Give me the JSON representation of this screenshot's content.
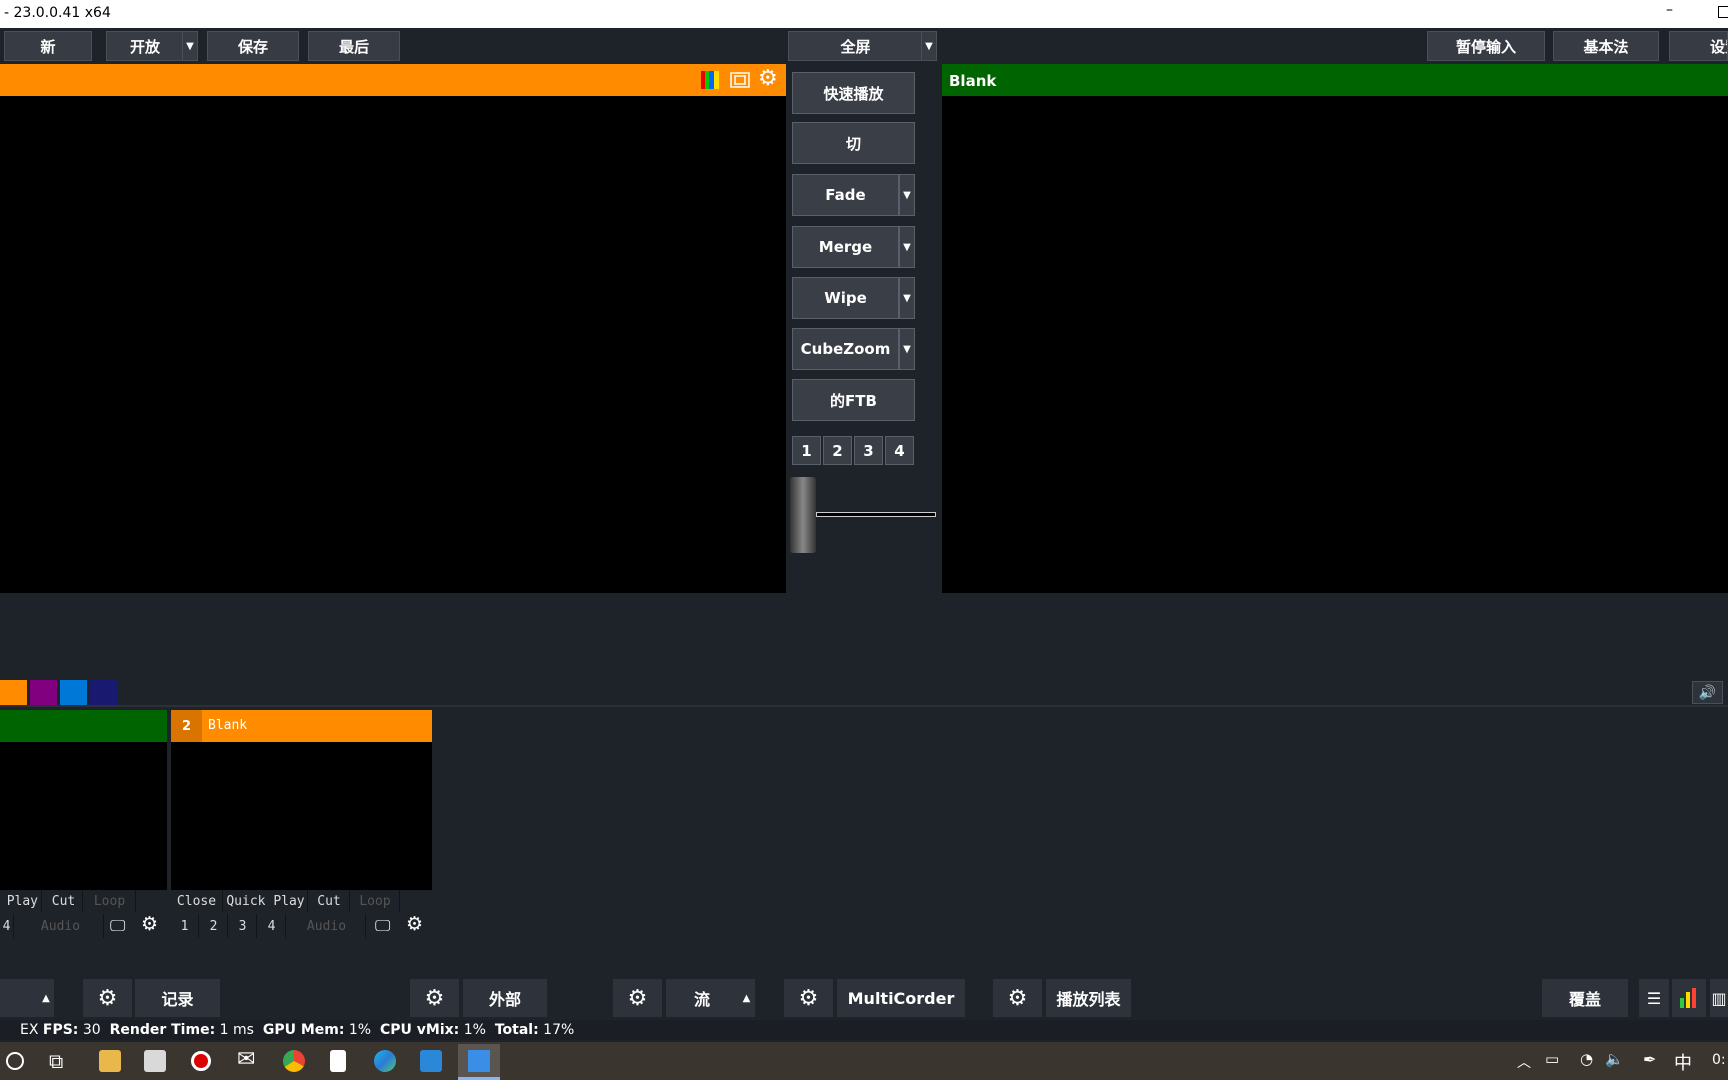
{
  "window": {
    "title": "- 23.0.0.41 x64",
    "min_glyph": "–"
  },
  "toolbar": {
    "new": "新",
    "open": "开放",
    "save": "保存",
    "last": "最后",
    "fullscreen": "全屏",
    "pause_input": "暂停输入",
    "basic": "基本法",
    "settings": "设置"
  },
  "output": {
    "label": "Blank"
  },
  "transitions": {
    "quick_play": "快速播放",
    "cut": "切",
    "fade": "Fade",
    "merge": "Merge",
    "wipe": "Wipe",
    "cubezoom": "CubeZoom",
    "ftb": "的FTB",
    "numbers": [
      "1",
      "2",
      "3",
      "4"
    ],
    "fader_position": 0.1
  },
  "colors": {
    "accent_orange": "#ff8c00",
    "output_green": "#006400",
    "blue": "#0078d7",
    "purple": "#800080",
    "navy": "#191970"
  },
  "input_tags": [
    "orange",
    "purple",
    "blue",
    "navy"
  ],
  "inputs": [
    {
      "header_color": "#006400",
      "controls": [
        "Play",
        "Cut",
        "Loop"
      ],
      "numbers": [
        "4"
      ],
      "audio": "Audio"
    },
    {
      "number": "2",
      "title": "Blank",
      "header_color": "#ff8c00",
      "controls": [
        "Close",
        "Quick Play",
        "Cut",
        "Loop"
      ],
      "numbers": [
        "1",
        "2",
        "3",
        "4"
      ],
      "audio": "Audio"
    }
  ],
  "bottom": {
    "record": "记录",
    "external": "外部",
    "stream": "流",
    "multicorder": "MultiCorder",
    "playlist": "播放列表",
    "overlay": "覆盖"
  },
  "status": {
    "mode": "EX",
    "fps_label": "FPS:",
    "fps": "30",
    "render_label": "Render Time:",
    "render": "1 ms",
    "gpu_label": "GPU Mem:",
    "gpu": "1%",
    "cpu_label": "CPU vMix:",
    "cpu": "1%",
    "total_label": "Total:",
    "total": "17%"
  },
  "taskbar": {
    "ime": "中",
    "clock": "0:"
  }
}
